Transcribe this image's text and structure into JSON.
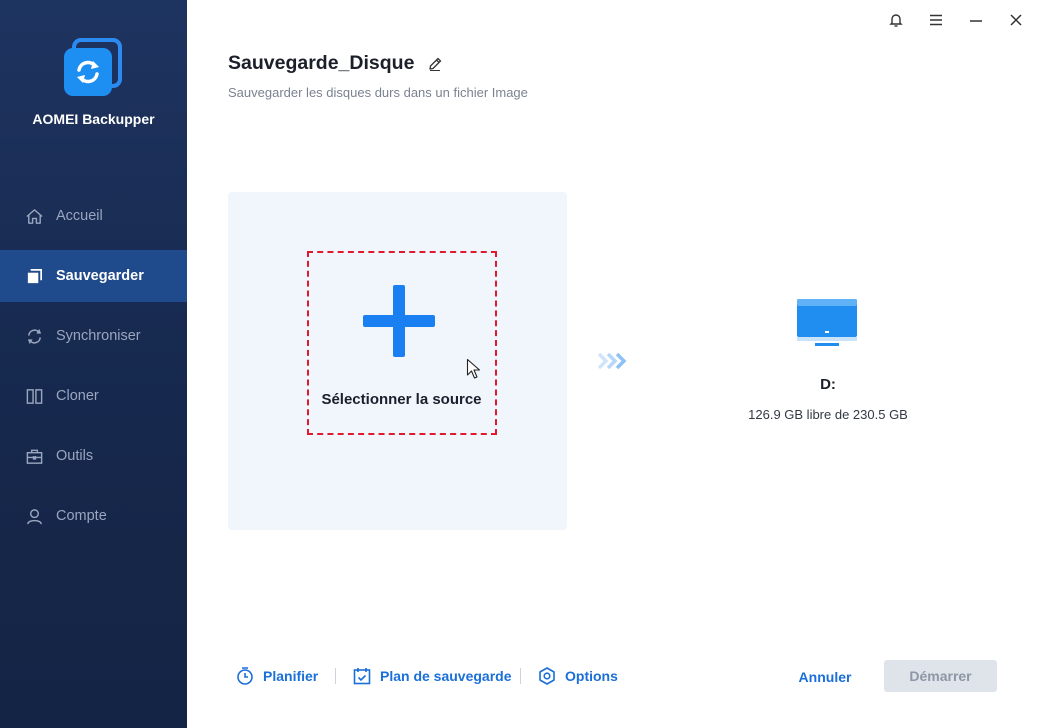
{
  "app": {
    "brand": "AOMEI Backupper"
  },
  "sidebar": {
    "items": [
      {
        "label": "Accueil",
        "icon": "home-icon"
      },
      {
        "label": "Sauvegarder",
        "icon": "backup-icon",
        "active": true
      },
      {
        "label": "Synchroniser",
        "icon": "sync-icon"
      },
      {
        "label": "Cloner",
        "icon": "clone-icon"
      },
      {
        "label": "Outils",
        "icon": "toolbox-icon"
      },
      {
        "label": "Compte",
        "icon": "user-icon"
      }
    ]
  },
  "window_controls": [
    "bell-icon",
    "menu-icon",
    "minimize-icon",
    "close-icon"
  ],
  "header": {
    "title": "Sauvegarde_Disque",
    "subtitle": "Sauvegarder les disques durs dans un fichier Image"
  },
  "source": {
    "label": "Sélectionner la source"
  },
  "destination": {
    "name": "D:",
    "space": "126.9 GB libre de 230.5 GB"
  },
  "bottom": {
    "schedule_label": "Planifier",
    "scheme_label": "Plan de sauvegarde",
    "options_label": "Options",
    "cancel_label": "Annuler",
    "start_label": "Démarrer"
  },
  "colors": {
    "sidebar_bg": "#1a2e56",
    "sidebar_active": "#1f4a8c",
    "accent": "#1a7ff0",
    "link": "#1a6fd8",
    "dashed_border": "#e0192f",
    "panel_bg": "#f1f6fc",
    "disabled_btn": "#dfe3ea"
  }
}
